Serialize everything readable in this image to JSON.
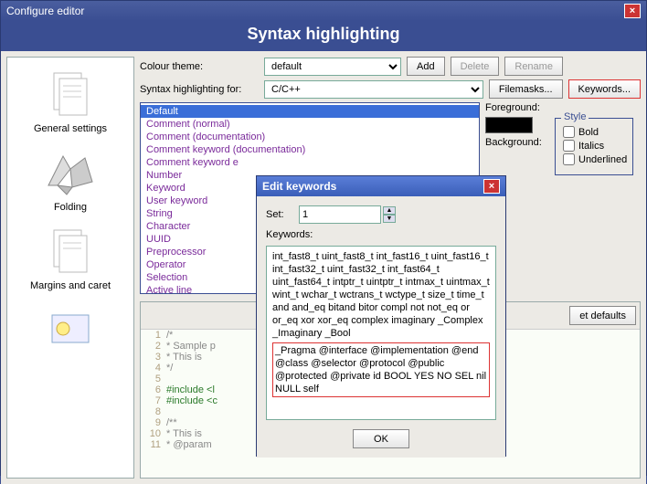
{
  "window": {
    "title": "Configure editor"
  },
  "page_title": "Syntax highlighting",
  "sidebar": {
    "items": [
      {
        "label": "General settings"
      },
      {
        "label": "Folding"
      },
      {
        "label": "Margins and caret"
      }
    ]
  },
  "theme": {
    "label": "Colour theme:",
    "value": "default",
    "add": "Add",
    "delete": "Delete",
    "rename": "Rename"
  },
  "syntax": {
    "label": "Syntax highlighting for:",
    "value": "C/C++",
    "filemasks": "Filemasks...",
    "keywords": "Keywords..."
  },
  "list": {
    "items": [
      "Default",
      "Comment (normal)",
      "Comment (documentation)",
      "Comment keyword (documentation)",
      "Comment keyword e",
      "Number",
      "Keyword",
      "User keyword",
      "String",
      "Character",
      "UUID",
      "Preprocessor",
      "Operator",
      "Selection",
      "Active line"
    ],
    "selected": 0
  },
  "fg": {
    "label": "Foreground:"
  },
  "bg": {
    "label": "Background:"
  },
  "style": {
    "legend": "Style",
    "bold": "Bold",
    "italics": "Italics",
    "underlined": "Underlined"
  },
  "reset": "et defaults",
  "code": {
    "lines": [
      {
        "n": 1,
        "t": "/*",
        "c": "cm"
      },
      {
        "n": 2,
        "t": " * Sample p",
        "c": "cm"
      },
      {
        "n": 3,
        "t": " * This is",
        "c": "cm"
      },
      {
        "n": 4,
        "t": " */",
        "c": "cm"
      },
      {
        "n": 5,
        "t": "",
        "c": ""
      },
      {
        "n": 6,
        "t": "#include <l",
        "c": "pre"
      },
      {
        "n": 7,
        "t": "#include <c",
        "c": "pre"
      },
      {
        "n": 8,
        "t": "",
        "c": ""
      },
      {
        "n": 9,
        "t": "/**",
        "c": "cm"
      },
      {
        "n": 10,
        "t": " * This is",
        "c": "cm"
      },
      {
        "n": 11,
        "t": " * @param",
        "c": "cm"
      }
    ]
  },
  "dialog": {
    "title": "Edit keywords",
    "set_label": "Set:",
    "set_value": "1",
    "kw_label": "Keywords:",
    "kw_text": "int_fast8_t uint_fast8_t int_fast16_t uint_fast16_t int_fast32_t uint_fast32_t int_fast64_t uint_fast64_t intptr_t uintptr_t intmax_t uintmax_t wint_t wchar_t wctrans_t wctype_t size_t time_t and and_eq bitand bitor compl not not_eq or or_eq xor xor_eq complex imaginary _Complex _Imaginary _Bool",
    "kw_highlight": "_Pragma @interface @implementation @end @class @selector @protocol @public @protected @private id BOOL YES NO SEL nil NULL self",
    "ok": "OK"
  }
}
